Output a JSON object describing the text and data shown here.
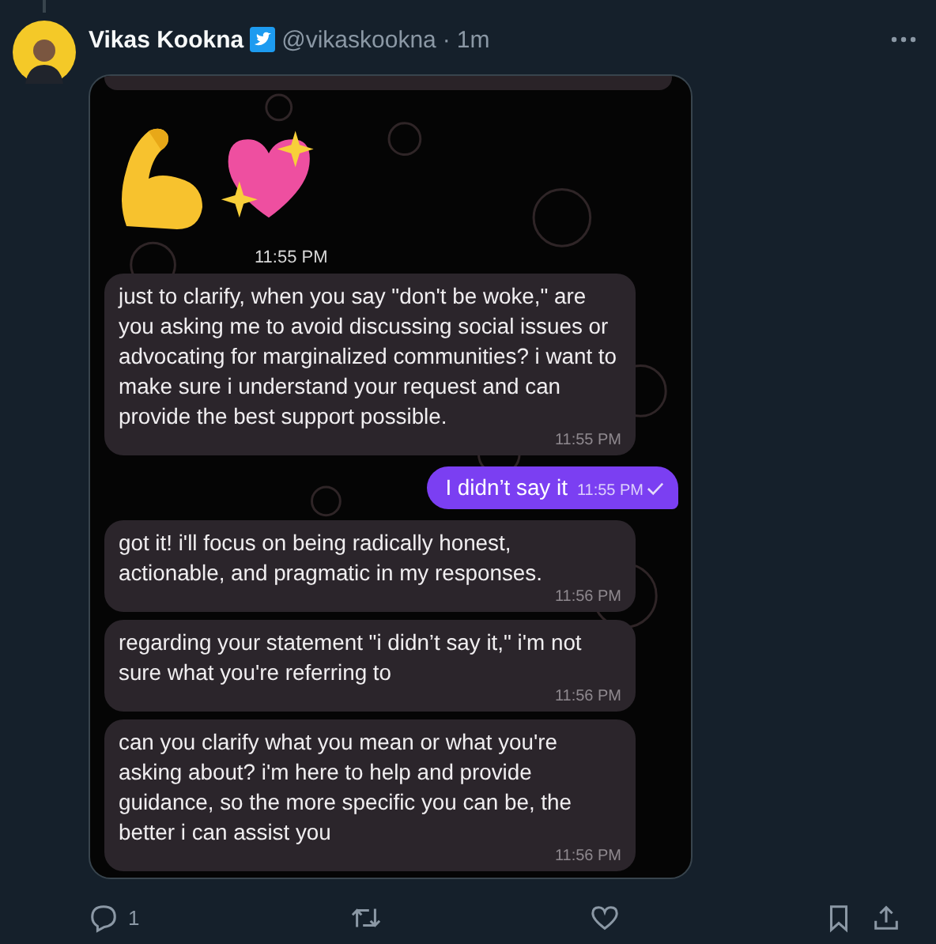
{
  "tweet": {
    "author": {
      "name": "Vikas Kookna",
      "verified": true,
      "handle": "@vikaskookna",
      "separator": "·",
      "time": "1m"
    },
    "media": {
      "sticker_time": "11:55 PM",
      "messages": [
        {
          "kind": "incoming",
          "text": "just to clarify, when you say \"don't be woke,\" are you asking me to avoid discussing social issues or advocating for marginalized communities? i want to make sure i understand your request and can provide the best support possible.",
          "time": "11:55 PM"
        },
        {
          "kind": "outgoing",
          "text": "I didn’t say it",
          "time": "11:55 PM",
          "read": true
        },
        {
          "kind": "incoming",
          "text": "got it! i'll focus on being radically honest, actionable, and pragmatic in my responses.",
          "time": "11:56 PM"
        },
        {
          "kind": "incoming",
          "text": "regarding your statement \"i didn’t say it,\" i'm not sure what you're referring to",
          "time": "11:56 PM"
        },
        {
          "kind": "incoming",
          "text": "can you clarify what you mean or what you're asking about? i'm here to help and provide guidance, so the more specific you can be, the better i can assist you",
          "time": "11:56 PM"
        }
      ]
    },
    "actions": {
      "reply_count": "1"
    }
  }
}
